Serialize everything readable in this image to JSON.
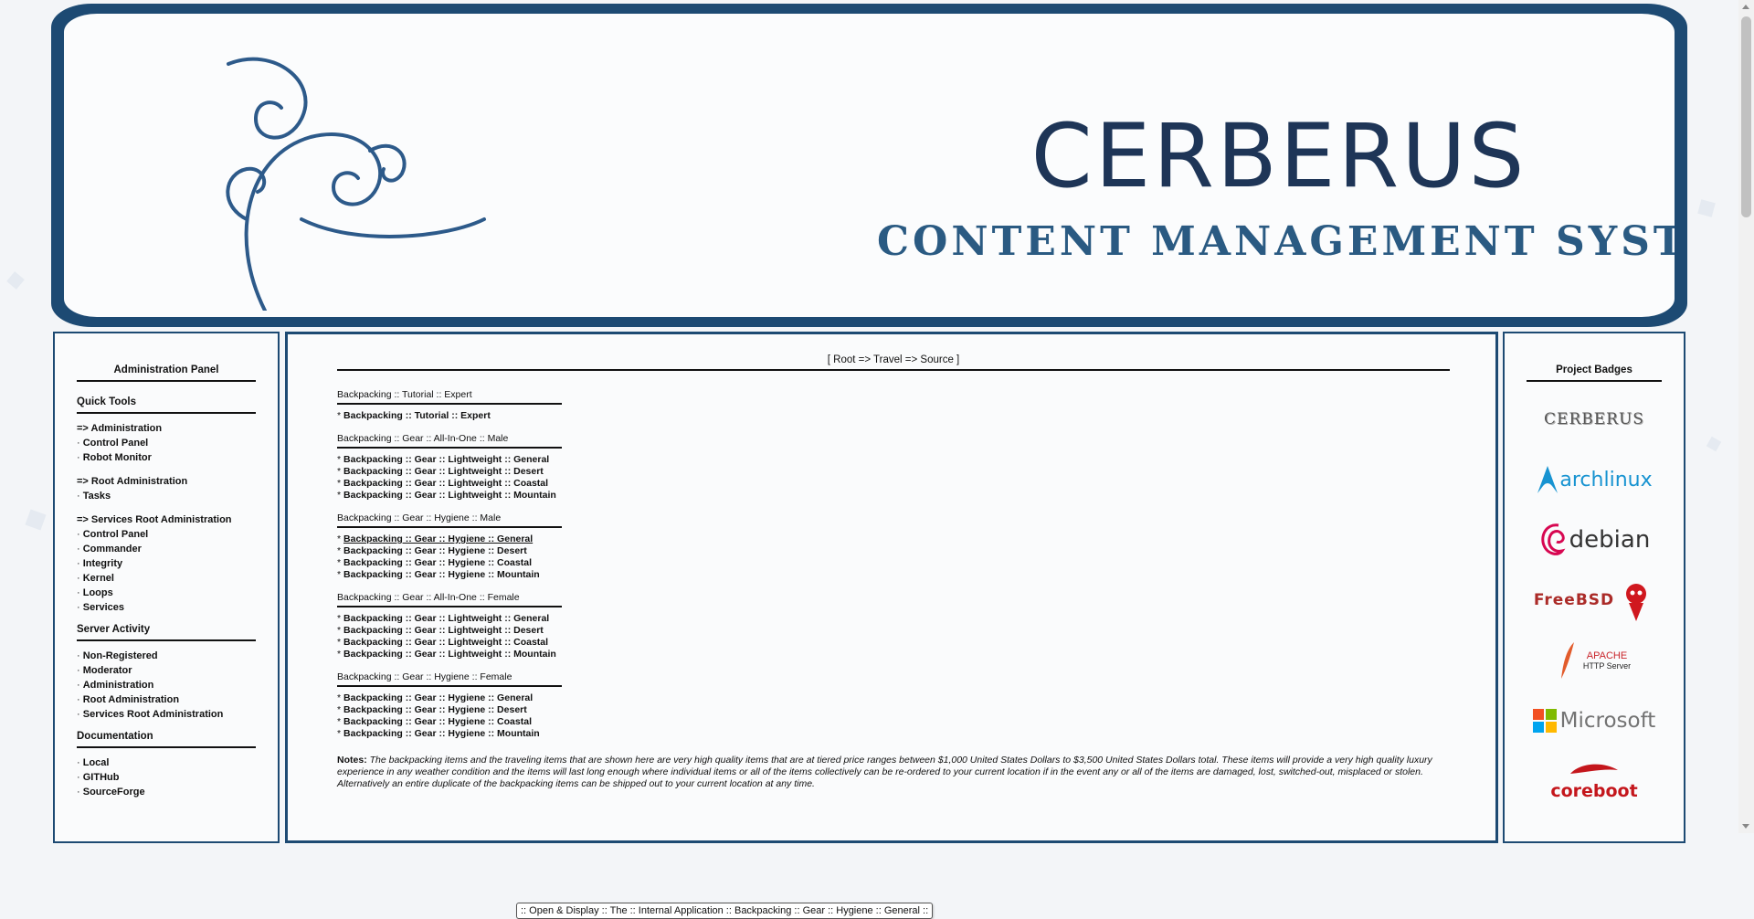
{
  "header": {
    "title": "CERBERUS",
    "subtitle": "CONTENT MANAGEMENT SYSTEM"
  },
  "left_panel": {
    "title": "Administration Panel",
    "quick_tools_title": "Quick Tools",
    "admin_group": [
      "=> Administration",
      "Control Panel",
      "Robot Monitor"
    ],
    "root_admin_group": [
      "=> Root Administration",
      "Tasks"
    ],
    "services_root_group": [
      "=> Services Root Administration",
      "Control Panel",
      "Commander",
      "Integrity",
      "Kernel",
      "Loops",
      "Services"
    ],
    "server_activity_title": "Server Activity",
    "server_activity": [
      "Non-Registered",
      "Moderator",
      "Administration",
      "Root Administration",
      "Services Root Administration"
    ],
    "documentation_title": "Documentation",
    "documentation": [
      "Local",
      "GITHub",
      "SourceForge"
    ]
  },
  "center": {
    "breadcrumb": "[ Root => Travel => Source ]",
    "groups": [
      {
        "heading": "Backpacking :: Tutorial :: Expert",
        "items": [
          "Backpacking :: Tutorial :: Expert"
        ]
      },
      {
        "heading": "Backpacking :: Gear :: All-In-One :: Male",
        "items": [
          "Backpacking :: Gear :: Lightweight :: General",
          "Backpacking :: Gear :: Lightweight :: Desert",
          "Backpacking :: Gear :: Lightweight :: Coastal",
          "Backpacking :: Gear :: Lightweight :: Mountain"
        ]
      },
      {
        "heading": "Backpacking :: Gear :: Hygiene :: Male",
        "items": [
          "Backpacking :: Gear :: Hygiene :: General",
          "Backpacking :: Gear :: Hygiene :: Desert",
          "Backpacking :: Gear :: Hygiene :: Coastal",
          "Backpacking :: Gear :: Hygiene :: Mountain"
        ]
      },
      {
        "heading": "Backpacking :: Gear :: All-In-One :: Female",
        "items": [
          "Backpacking :: Gear :: Lightweight :: General",
          "Backpacking :: Gear :: Lightweight :: Desert",
          "Backpacking :: Gear :: Lightweight :: Coastal",
          "Backpacking :: Gear :: Lightweight :: Mountain"
        ]
      },
      {
        "heading": "Backpacking :: Gear :: Hygiene :: Female",
        "items": [
          "Backpacking :: Gear :: Hygiene :: General",
          "Backpacking :: Gear :: Hygiene :: Desert",
          "Backpacking :: Gear :: Hygiene :: Coastal",
          "Backpacking :: Gear :: Hygiene :: Mountain"
        ]
      }
    ],
    "notes_label": "Notes",
    "notes_text": "The backpacking items and the traveling items that are shown here are very high quality items that are at tiered price ranges between $1,000 United States Dollars to $3,500 United States Dollars total. These items will provide a very high quality luxury experience in any weather condition and the items will last long enough where individual items or all of the items collectively can be re-ordered to your current location if in the event any or all of the items are damaged, lost, switched-out, misplaced or stolen. Alternatively an entire duplicate of the backpacking items can be shipped out to your current location at any time.",
    "tooltip": ":: Open & Display :: The :: Internal Application :: Backpacking :: Gear :: Hygiene :: General ::"
  },
  "right_panel": {
    "title": "Project Badges",
    "badges": [
      {
        "icon": "cerberus-badge-icon",
        "label": "CERBERUS",
        "color": "#555555"
      },
      {
        "icon": "archlinux-logo-icon",
        "label": "archlinux",
        "color": "#1793d1"
      },
      {
        "icon": "debian-logo-icon",
        "label": "debian",
        "color": "#333333"
      },
      {
        "icon": "freebsd-logo-icon",
        "label": "FreeBSD",
        "color": "#ab2b28"
      },
      {
        "icon": "apache-logo-icon",
        "label": "APACHE",
        "sub": "HTTP Server",
        "color": "#c9252b"
      },
      {
        "icon": "microsoft-logo-icon",
        "label": "Microsoft",
        "color": "#737373"
      },
      {
        "icon": "coreboot-logo-icon",
        "label": "coreboot",
        "color": "#c4161c"
      }
    ]
  },
  "colors": {
    "frame": "#1d4a73",
    "title": "#1e3557",
    "subtitle": "#2a5a82"
  }
}
